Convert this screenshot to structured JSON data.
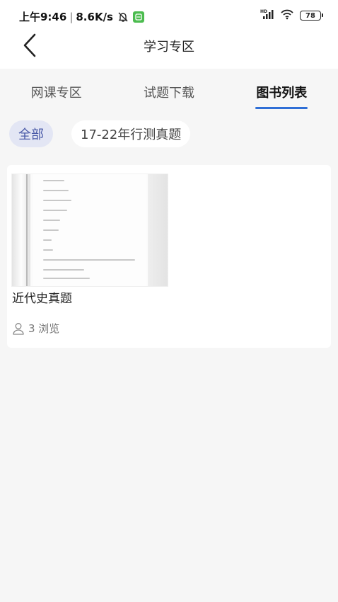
{
  "status_bar": {
    "time": "上午9:46",
    "network_speed": "8.6K/s",
    "signal_label": "HD",
    "battery_level": "78"
  },
  "header": {
    "title": "学习专区"
  },
  "tabs": [
    {
      "label": "网课专区",
      "active": false
    },
    {
      "label": "试题下载",
      "active": false
    },
    {
      "label": "图书列表",
      "active": true
    }
  ],
  "filters": [
    {
      "label": "全部",
      "selected": true
    },
    {
      "label": "17-22年行测真题",
      "selected": false
    }
  ],
  "books": [
    {
      "title": "近代史真题",
      "views": "3 浏览"
    }
  ],
  "colors": {
    "accent": "#2f6fd6",
    "chip_selected_bg": "#e3e6f4",
    "chip_selected_text": "#4a5aa8",
    "page_bg": "#f6f6f6"
  }
}
